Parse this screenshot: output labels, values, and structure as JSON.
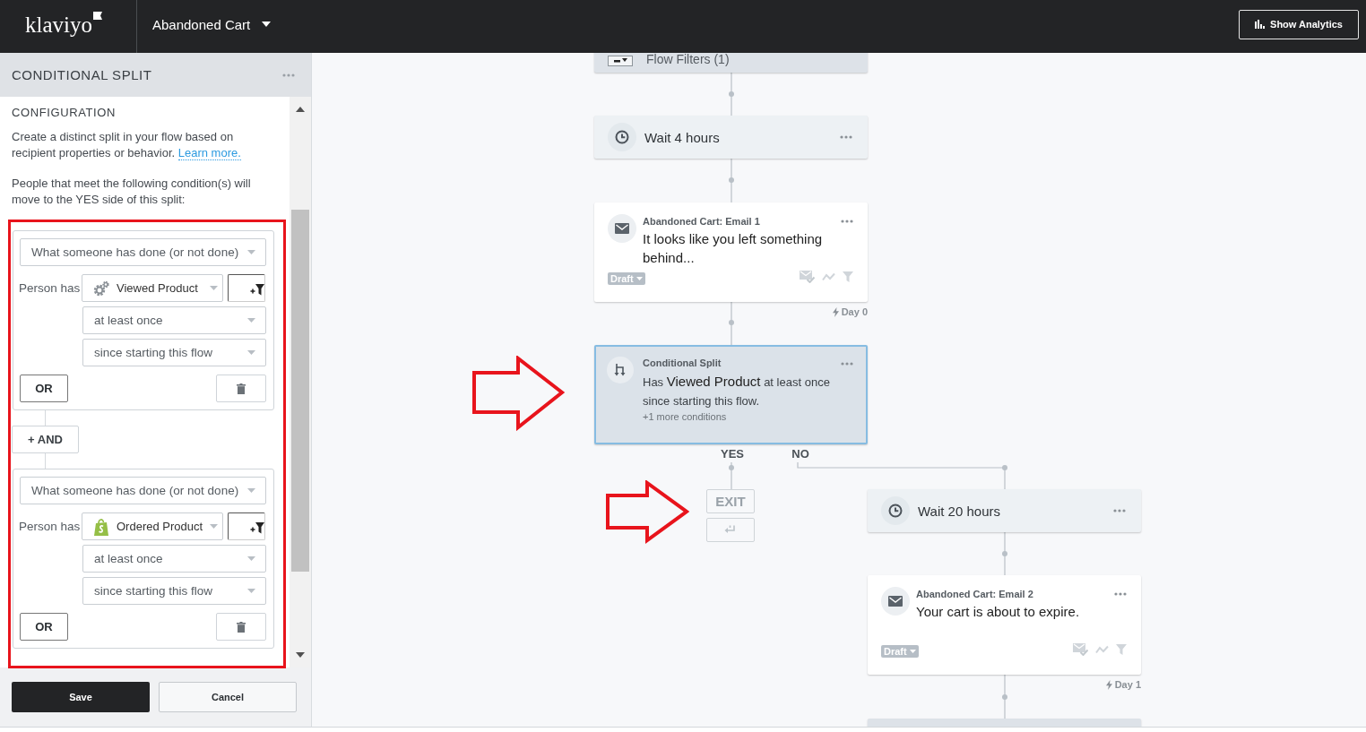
{
  "topbar": {
    "logo": "klaviyo",
    "flow_name": "Abandoned Cart",
    "analytics_button": "Show Analytics"
  },
  "panel": {
    "title": "CONDITIONAL SPLIT",
    "section_title": "CONFIGURATION",
    "intro": "Create a distinct split in your flow based on recipient properties or behavior.",
    "learn_more": "Learn more.",
    "rule_text": "People that meet the following condition(s) will move to the YES side of this split:",
    "condition_groups": [
      {
        "kind": "custom",
        "condition_type": "What someone has done (or not done)",
        "person_label": "Person has",
        "metric": "Viewed Product",
        "frequency": "at least once",
        "timeframe": "since starting this flow",
        "or_button": "OR"
      },
      {
        "kind": "store",
        "condition_type": "What someone has done (or not done)",
        "person_label": "Person has",
        "metric": "Ordered Product",
        "frequency": "at least once",
        "timeframe": "since starting this flow",
        "or_button": "OR"
      }
    ],
    "and_button": "+ AND",
    "save_button": "Save",
    "cancel_button": "Cancel"
  },
  "canvas": {
    "nodes": [
      {
        "kind": "filter",
        "label": "Flow Filters (1)",
        "selected": false
      },
      {
        "kind": "wait",
        "label": "Wait 4 hours",
        "selected": false
      },
      {
        "kind": "email",
        "title": "Abandoned Cart: Email 1",
        "subject": "It looks like you left something behind...",
        "status": "Draft",
        "day": "Day 0",
        "selected": false
      },
      {
        "kind": "split",
        "title": "Conditional Split",
        "condition": {
          "lead": "Has",
          "event": "Viewed Product",
          "rest": "at least once since starting this flow."
        },
        "more": "+1 more conditions",
        "yes_label": "YES",
        "no_label": "NO",
        "selected": true
      },
      {
        "kind": "exit",
        "label": "EXIT",
        "selected": false
      },
      {
        "kind": "wait",
        "label": "Wait 20 hours",
        "selected": false
      },
      {
        "kind": "email",
        "title": "Abandoned Cart: Email 2",
        "subject": "Your cart is about to expire.",
        "status": "Draft",
        "day": "Day 1",
        "selected": false
      },
      {
        "kind": "step",
        "selected": false
      }
    ]
  },
  "annotations": [
    {
      "kind": "frame"
    },
    {
      "kind": "arrow"
    },
    {
      "kind": "arrow"
    }
  ]
}
